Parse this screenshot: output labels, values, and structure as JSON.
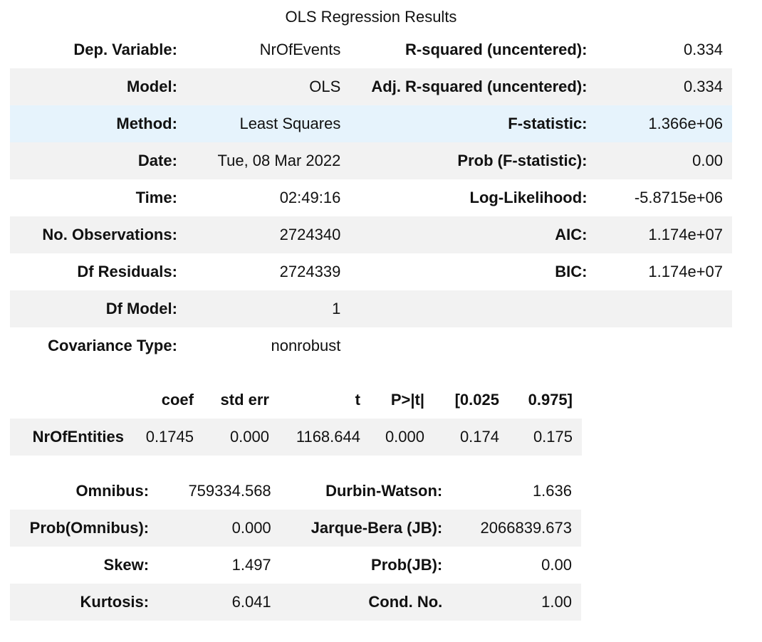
{
  "title": "OLS Regression Results",
  "summary": [
    {
      "label1": "Dep. Variable:",
      "value1": "NrOfEvents",
      "label2": "R-squared (uncentered):",
      "value2": "0.334"
    },
    {
      "label1": "Model:",
      "value1": "OLS",
      "label2": "Adj. R-squared (uncentered):",
      "value2": "0.334"
    },
    {
      "label1": "Method:",
      "value1": "Least Squares",
      "label2": "F-statistic:",
      "value2": "1.366e+06"
    },
    {
      "label1": "Date:",
      "value1": "Tue, 08 Mar 2022",
      "label2": "Prob (F-statistic):",
      "value2": "0.00"
    },
    {
      "label1": "Time:",
      "value1": "02:49:16",
      "label2": "Log-Likelihood:",
      "value2": "-5.8715e+06"
    },
    {
      "label1": "No. Observations:",
      "value1": "2724340",
      "label2": "AIC:",
      "value2": "1.174e+07"
    },
    {
      "label1": "Df Residuals:",
      "value1": "2724339",
      "label2": "BIC:",
      "value2": "1.174e+07"
    },
    {
      "label1": "Df Model:",
      "value1": "1",
      "label2": "",
      "value2": ""
    },
    {
      "label1": "Covariance Type:",
      "value1": "nonrobust",
      "label2": "",
      "value2": ""
    }
  ],
  "coef_table": {
    "headers": [
      "",
      "coef",
      "std err",
      "t",
      "P>|t|",
      "[0.025",
      "0.975]"
    ],
    "rows": [
      {
        "name": "NrOfEntities",
        "coef": "0.1745",
        "std_err": "0.000",
        "t": "1168.644",
        "p": "0.000",
        "lo": "0.174",
        "hi": "0.175"
      }
    ]
  },
  "diagnostics": [
    {
      "label1": "Omnibus:",
      "value1": "759334.568",
      "label2": "Durbin-Watson:",
      "value2": "1.636"
    },
    {
      "label1": "Prob(Omnibus):",
      "value1": "0.000",
      "label2": "Jarque-Bera (JB):",
      "value2": "2066839.673"
    },
    {
      "label1": "Skew:",
      "value1": "1.497",
      "label2": "Prob(JB):",
      "value2": "0.00"
    },
    {
      "label1": "Kurtosis:",
      "value1": "6.041",
      "label2": "Cond. No.",
      "value2": "1.00"
    }
  ],
  "colors": {
    "stripe": "#f2f2f2",
    "hover_highlight": "#e6f3fc",
    "text": "#111111"
  }
}
